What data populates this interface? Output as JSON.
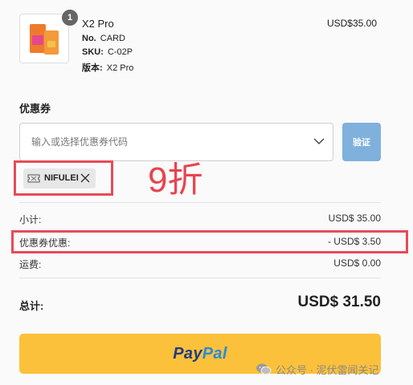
{
  "product": {
    "quantity": "1",
    "name": "X2 Pro",
    "no_label": "No.",
    "no_value": "CARD",
    "sku_label": "SKU:",
    "sku_value": "C-02P",
    "version_label": "版本:",
    "version_value": "X2 Pro",
    "price": "USD$35.00"
  },
  "coupon": {
    "title": "优惠券",
    "placeholder": "输入或选择优惠券代码",
    "verify_label": "验证",
    "applied_code": "NIFULEI"
  },
  "annotation": "9折",
  "summary": {
    "subtotal_label": "小计:",
    "subtotal_value": "USD$ 35.00",
    "discount_label": "优惠券优惠:",
    "discount_value": "- USD$ 3.50",
    "shipping_label": "运费:",
    "shipping_value": "USD$ 0.00",
    "total_label": "总计:",
    "total_value": "USD$ 31.50"
  },
  "paypal": {
    "part1": "Pay",
    "part2": "Pal"
  },
  "watermark": "公众号 · 泥伏雷闻关记",
  "colors": {
    "accent_blue": "#7fb1dc",
    "paypal_yellow": "#fcc13a",
    "annotation_red": "#e54b58"
  },
  "icons": [
    "card-product-image",
    "chevron-down-icon",
    "coupon-tag-icon",
    "close-icon",
    "wechat-icon"
  ]
}
